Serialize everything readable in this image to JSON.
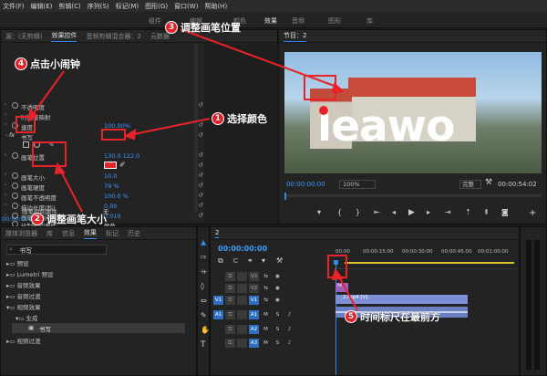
{
  "menu": [
    "文件(F)",
    "编辑(E)",
    "剪辑(C)",
    "序列(S)",
    "标记(M)",
    "图形(G)",
    "窗口(W)",
    "帮助(H)"
  ],
  "workspace": [
    "组件",
    "编辑",
    "颜色",
    "效果",
    "音频",
    "图形",
    "库"
  ],
  "left_tabs": [
    "源：(无剪辑)",
    "效果控件",
    "音频剪辑混合器：2",
    "元数据"
  ],
  "ec": {
    "rows": [
      {
        "label": "不透明度",
        "value": ""
      },
      {
        "label": "时间重映射",
        "value": ""
      },
      {
        "label": "速度",
        "value": "100.00%"
      },
      {
        "label": "书写",
        "value": ""
      },
      {
        "label": "",
        "value": ""
      },
      {
        "label": "画笔位置",
        "value": "130.0   122.0"
      },
      {
        "label": "",
        "value": ""
      },
      {
        "label": "画笔大小",
        "value": "10.0"
      },
      {
        "label": "画笔硬度",
        "value": "79 %"
      },
      {
        "label": "画笔不透明度",
        "value": "100.0 %"
      },
      {
        "label": "描边长度(秒)",
        "value": "0.00"
      },
      {
        "label": "画笔间隔(秒)",
        "value": "0.010"
      },
      {
        "label": "绘制时间属性",
        "value": "颜色"
      },
      {
        "label": "画笔时间属性",
        "value": "无"
      }
    ],
    "time": "00:00:00:00",
    "fx": "fx"
  },
  "monitor": {
    "tab": "节目：2",
    "overlay": "leawo",
    "tc_left": "00:00:00:00",
    "zoom": "100%",
    "quality": "完整",
    "tc_right": "00:00:54:02"
  },
  "project_tabs": [
    "媒体浏览器",
    "库",
    "信息",
    "效果",
    "标记",
    "历史"
  ],
  "search": "书写",
  "tree": [
    "预设",
    "Lumetri 预设",
    "音频效果",
    "音频过渡",
    "视频效果",
    "生成",
    "书写",
    "视频过渡"
  ],
  "timeline": {
    "tab": "2",
    "time": "00:00:00:00",
    "ruler": [
      "00:00",
      "00:00:15:00",
      "00:00:30:00",
      "00:00:45:00",
      "00:01:00:00"
    ],
    "tracks": [
      "V3",
      "V2",
      "V1",
      "A1",
      "A2",
      "A3"
    ],
    "clip_fx": "fx",
    "clip_name": "2.mp4 [V]"
  },
  "callouts": {
    "c1": {
      "n": "1",
      "t": "选择颜色"
    },
    "c2": {
      "n": "2",
      "t": "调整画笔大小"
    },
    "c3": {
      "n": "3",
      "t": "调整画笔位置"
    },
    "c4": {
      "n": "4",
      "t": "点击小闹钟"
    },
    "c5": {
      "n": "5",
      "t": "时间标尺在最前方"
    }
  },
  "colors": {
    "accent": "#2d8ceb",
    "callout": "#e8232a",
    "clip": "#7e8fd6",
    "brush": "#e8232a"
  }
}
